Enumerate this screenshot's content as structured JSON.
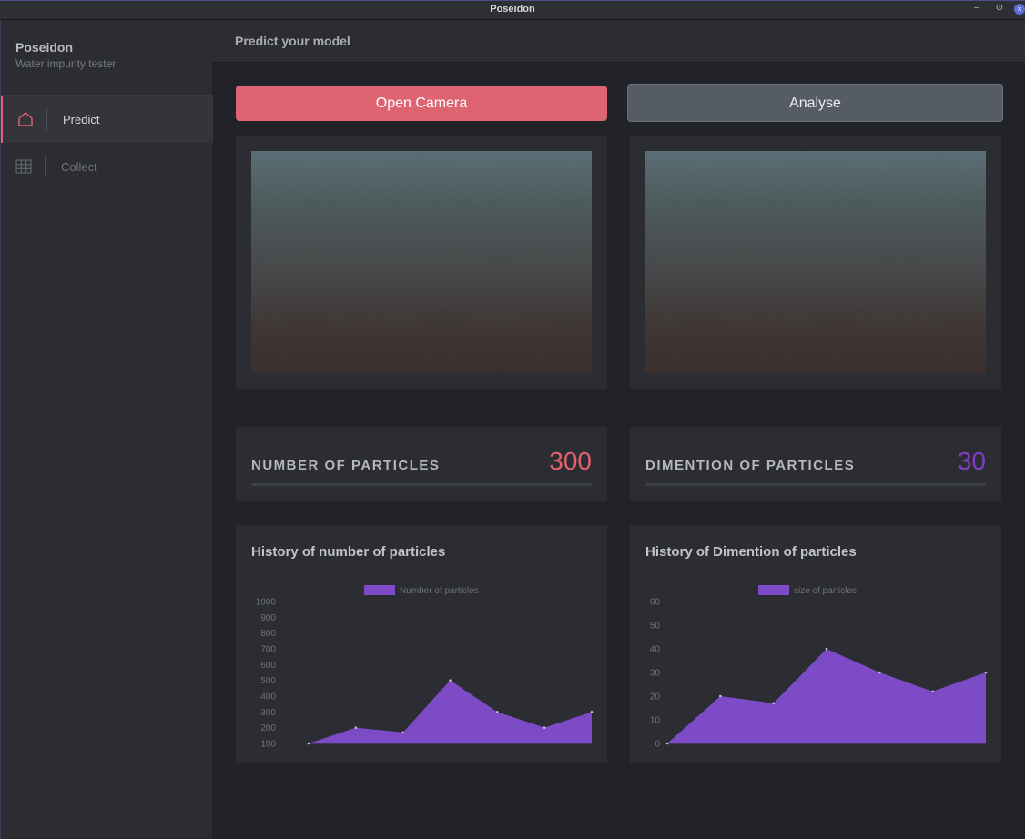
{
  "window": {
    "title": "Poseidon",
    "min_glyph": "–",
    "max_glyph": "⊙",
    "close_glyph": "×"
  },
  "sidebar": {
    "app_name": "Poseidon",
    "app_subtitle": "Water impurity tester",
    "items": [
      {
        "label": "Predict",
        "icon": "home-icon",
        "active": true
      },
      {
        "label": "Collect",
        "icon": "table-grid-icon",
        "active": false
      }
    ]
  },
  "header": {
    "title": "Predict your model"
  },
  "buttons": {
    "open_camera": "Open Camera",
    "analyse": "Analyse"
  },
  "stats": {
    "particles": {
      "label": "NUMBER OF PARTICLES",
      "value": "300"
    },
    "dimension": {
      "label": "DIMENTION OF PARTICLES",
      "value": "30"
    }
  },
  "colors": {
    "accent_pink": "#df6472",
    "accent_purple": "#7e4bc6",
    "panel": "#2b2d32",
    "background": "#212328"
  },
  "charts": {
    "count": {
      "title": "History of number of particles"
    },
    "size": {
      "title": "History of Dimention of particles"
    }
  },
  "chart_data": [
    {
      "type": "area",
      "title": "History of number of particles",
      "series": [
        {
          "name": "Number of particles",
          "values": [
            100,
            200,
            170,
            500,
            300,
            200,
            300
          ]
        }
      ],
      "x": [
        1,
        2,
        3,
        4,
        5,
        6,
        7
      ],
      "ylim": [
        100,
        1000
      ],
      "yticks": [
        1000,
        900,
        800,
        700,
        600,
        500,
        400,
        300,
        200,
        100
      ],
      "legend": "top-center",
      "grid": false
    },
    {
      "type": "area",
      "title": "History of Dimention of particles",
      "series": [
        {
          "name": "size of particles",
          "values": [
            0,
            20,
            17,
            40,
            30,
            22,
            30
          ]
        }
      ],
      "x": [
        1,
        2,
        3,
        4,
        5,
        6,
        7
      ],
      "ylim": [
        0,
        60
      ],
      "yticks": [
        60,
        50,
        40,
        30,
        20,
        10,
        0
      ],
      "legend": "top-center",
      "grid": false
    }
  ]
}
